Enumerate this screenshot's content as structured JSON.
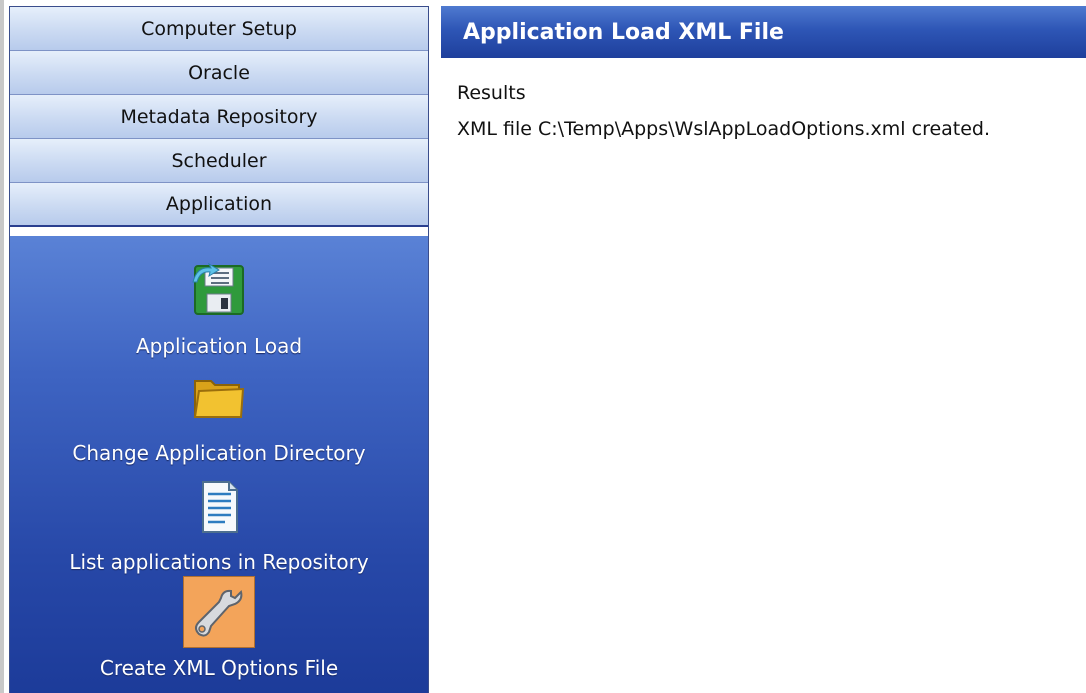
{
  "sidebar": {
    "groups": [
      {
        "label": "Computer Setup"
      },
      {
        "label": "Oracle"
      },
      {
        "label": "Metadata Repository"
      },
      {
        "label": "Scheduler"
      },
      {
        "label": "Application"
      }
    ],
    "tasks": [
      {
        "label": "Application Load",
        "icon": "floppy-disk-icon"
      },
      {
        "label": "Change Application Directory",
        "icon": "folder-icon"
      },
      {
        "label": "List applications in Repository",
        "icon": "document-list-icon"
      },
      {
        "label": "Create XML Options File",
        "icon": "wrench-icon",
        "selected": true
      }
    ]
  },
  "main": {
    "title": "Application Load XML File",
    "results_heading": "Results",
    "results_message": "XML file C:\\Temp\\Apps\\WslAppLoadOptions.xml created."
  },
  "colors": {
    "sidebar_tasks_bg": "#2748a8",
    "header_bg": "#2e56b6",
    "selected_task_bg": "#f3a45a"
  }
}
